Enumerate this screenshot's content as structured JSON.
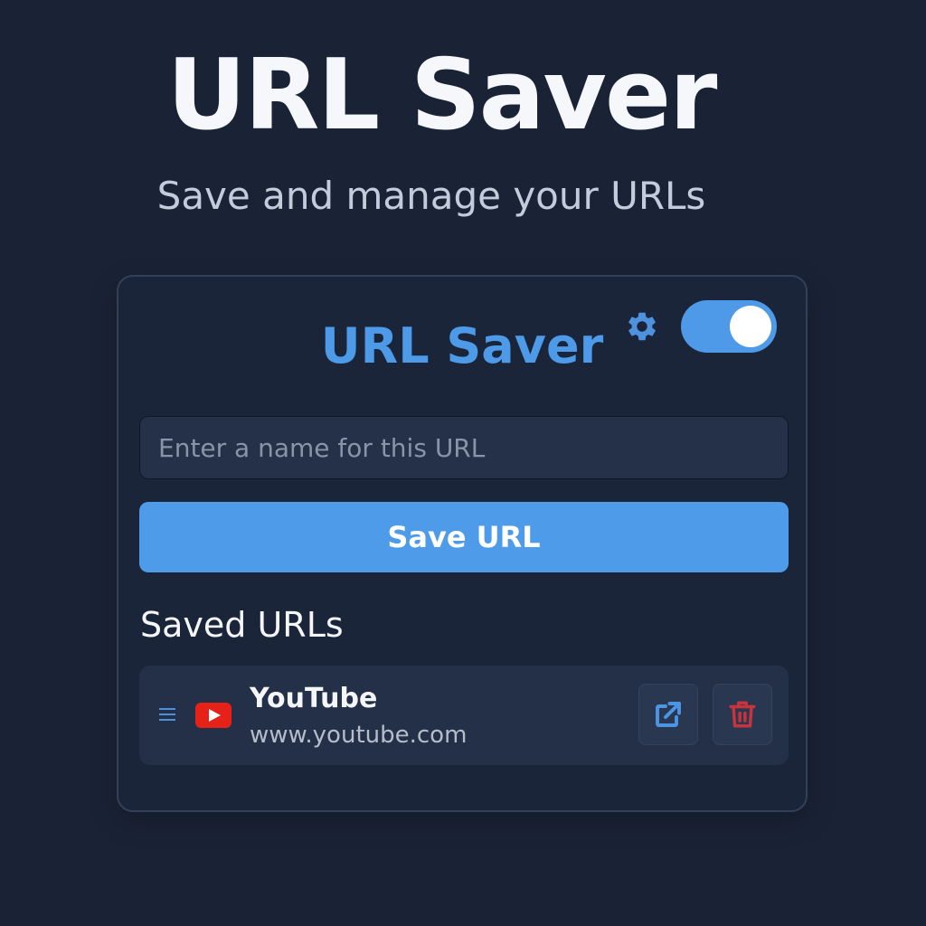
{
  "hero": {
    "title": "URL Saver",
    "subtitle": "Save and manage your URLs"
  },
  "card": {
    "title": "URL Saver",
    "settings_icon": "gear-icon",
    "toggle": {
      "state": "on",
      "color": "#4e99e8"
    },
    "name_input": {
      "value": "",
      "placeholder": "Enter a name for this URL"
    },
    "save_button_label": "Save URL",
    "saved_heading": "Saved URLs",
    "saved_urls": [
      {
        "name": "YouTube",
        "url": "www.youtube.com",
        "favicon": "youtube-icon",
        "actions": [
          "open-external-icon",
          "trash-icon"
        ]
      }
    ]
  },
  "colors": {
    "background": "#1a2336",
    "accent": "#4e9bea",
    "danger": "#c9343c",
    "youtube_red": "#e62117"
  }
}
